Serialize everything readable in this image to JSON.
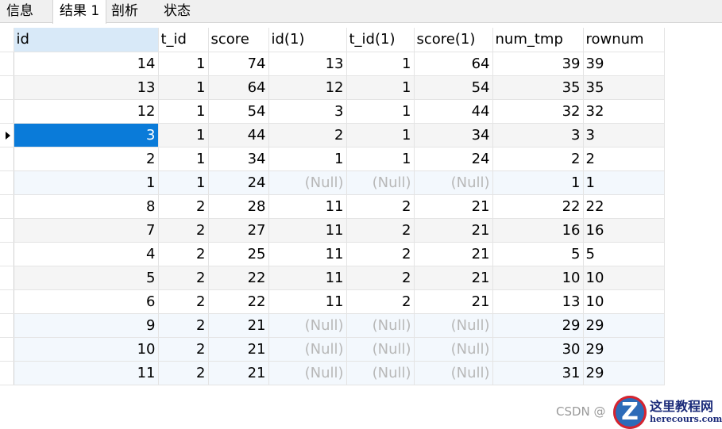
{
  "tabs": [
    {
      "label": "信息",
      "active": false
    },
    {
      "label": "结果 1",
      "active": true
    },
    {
      "label": "剖析",
      "active": false
    },
    {
      "label": "状态",
      "active": false
    }
  ],
  "grid": {
    "columns": [
      "id",
      "t_id",
      "score",
      "id(1)",
      "t_id(1)",
      "score(1)",
      "num_tmp",
      "rownum"
    ],
    "sorted_column": "id",
    "selected_row_index": 3,
    "selected_color": "#0a7bd9",
    "null_label": "(Null)",
    "rows": [
      [
        "14",
        "1",
        "74",
        "13",
        "1",
        "64",
        "39",
        "39"
      ],
      [
        "13",
        "1",
        "64",
        "12",
        "1",
        "54",
        "35",
        "35"
      ],
      [
        "12",
        "1",
        "54",
        "3",
        "1",
        "44",
        "32",
        "32"
      ],
      [
        "3",
        "1",
        "44",
        "2",
        "1",
        "34",
        "3",
        "3"
      ],
      [
        "2",
        "1",
        "34",
        "1",
        "1",
        "24",
        "2",
        "2"
      ],
      [
        "1",
        "1",
        "24",
        null,
        null,
        null,
        "1",
        "1"
      ],
      [
        "8",
        "2",
        "28",
        "11",
        "2",
        "21",
        "22",
        "22"
      ],
      [
        "7",
        "2",
        "27",
        "11",
        "2",
        "21",
        "16",
        "16"
      ],
      [
        "4",
        "2",
        "25",
        "11",
        "2",
        "21",
        "5",
        "5"
      ],
      [
        "5",
        "2",
        "22",
        "11",
        "2",
        "21",
        "10",
        "10"
      ],
      [
        "6",
        "2",
        "22",
        "11",
        "2",
        "21",
        "13",
        "10"
      ],
      [
        "9",
        "2",
        "21",
        null,
        null,
        null,
        "29",
        "29"
      ],
      [
        "10",
        "2",
        "21",
        null,
        null,
        null,
        "30",
        "29"
      ],
      [
        "11",
        "2",
        "21",
        null,
        null,
        null,
        "31",
        "29"
      ]
    ]
  },
  "watermark": "CSDN @",
  "logo": {
    "mark": "Z",
    "title": "这里教程网",
    "subtitle": "herecours.com"
  }
}
